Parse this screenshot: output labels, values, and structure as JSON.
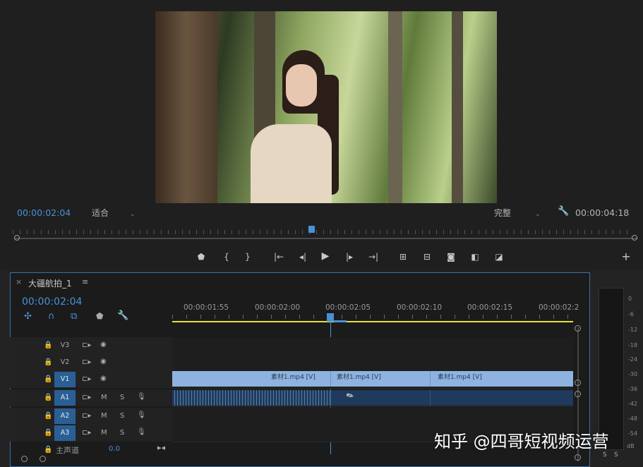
{
  "monitor": {
    "current_time": "00:00:02:04",
    "zoom_select": "适合",
    "quality_select": "完整",
    "duration": "00:00:04:18"
  },
  "transport": [
    "marker",
    "in",
    "out",
    "go-to-in",
    "step-back",
    "play",
    "step-forward",
    "go-to-out",
    "lift",
    "extract",
    "export-frame",
    "compare",
    "overlay",
    "add"
  ],
  "timeline": {
    "sequence_name": "大疆航拍_1",
    "menu_icon": "≡",
    "close_icon": "×",
    "timecode": "00:00:02:04",
    "ruler": [
      "00:00:01:55",
      "00:00:02:00",
      "00:00:02:05",
      "00:00:02:10",
      "00:00:02:15",
      "00:00:02:2"
    ],
    "tracks": {
      "v3": "V3",
      "v2": "V2",
      "v1": "V1",
      "v1_patch": "V1",
      "a1": "A1",
      "a2": "A2",
      "a3": "A3",
      "a1_patch": "A1",
      "a2_patch": "A2",
      "a3_patch": "A3",
      "m": "M",
      "s": "S"
    },
    "clips": [
      {
        "label": "素材1.mp4 [V]"
      },
      {
        "label": "素材1.mp4 [V]"
      },
      {
        "label": "素材1.mp4 [V]"
      }
    ],
    "master": {
      "label": "主声道",
      "value": "0.0"
    }
  },
  "meter": {
    "scale": [
      "0",
      "-6",
      "-12",
      "-18",
      "-24",
      "-30",
      "-36",
      "-42",
      "-48",
      "-54",
      "dB"
    ],
    "solo": [
      "S",
      "S"
    ]
  },
  "watermark": "知乎 @四哥短视频运营",
  "colors": {
    "accent": "#4a90d9",
    "clip": "#8eb3e0",
    "playhead": "#4a90d9",
    "workarea": "#e8e23a"
  }
}
